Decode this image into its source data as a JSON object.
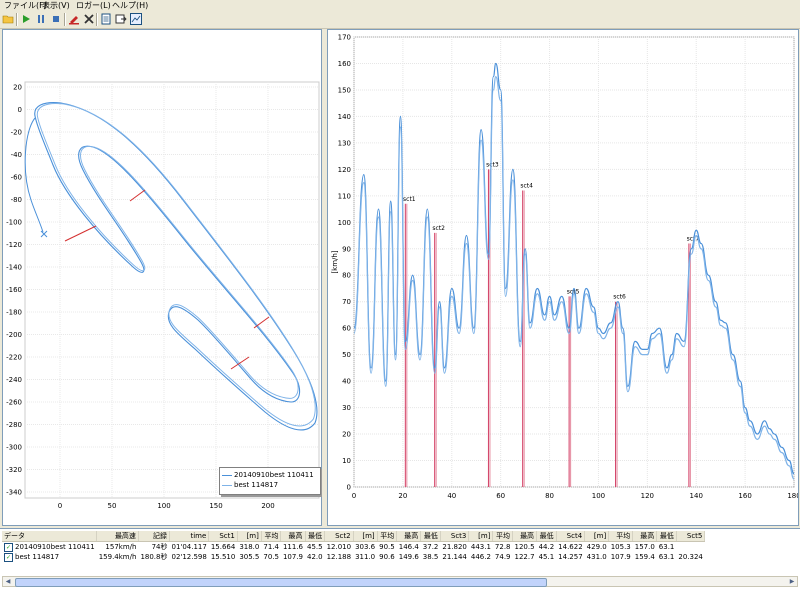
{
  "menu": [
    {
      "label": "ファイル(F)"
    },
    {
      "label": "表示(V)"
    },
    {
      "label": "ロガー(L)"
    },
    {
      "label": "ヘルプ(H)"
    }
  ],
  "toolbar": {
    "icons": [
      "open-folder-icon",
      "play-icon",
      "pause-icon",
      "stop-icon",
      "marker-icon",
      "delete-icon",
      "report-icon",
      "export-icon",
      "chart-icon"
    ]
  },
  "track_map": {
    "y_ticks": [
      "20",
      "0",
      "-20",
      "-40",
      "-60",
      "-80",
      "-100",
      "-120",
      "-140",
      "-160",
      "-180",
      "-200",
      "-220",
      "-240",
      "-260",
      "-280",
      "-300",
      "-320",
      "-340"
    ],
    "x_ticks": [
      "0",
      "50",
      "100",
      "150",
      "200"
    ],
    "legend": [
      "20140910best 110411",
      "best 114817"
    ]
  },
  "chart_data": {
    "type": "line",
    "ylabel": "[km/h]",
    "xlim": [
      0,
      180
    ],
    "ylim": [
      0,
      170
    ],
    "x_ticks": [
      "0",
      "20",
      "40",
      "60",
      "80",
      "100",
      "120",
      "140",
      "160",
      "180"
    ],
    "y_ticks": [
      "0",
      "10",
      "20",
      "30",
      "40",
      "50",
      "60",
      "70",
      "80",
      "90",
      "100",
      "110",
      "120",
      "130",
      "140",
      "150",
      "160",
      "170"
    ],
    "series": [
      {
        "name": "20140910best 110411",
        "color": "#4a90d9",
        "x": [
          0,
          4,
          7,
          10,
          13,
          15,
          17,
          19,
          21,
          24,
          27,
          30,
          33,
          35,
          37,
          40,
          43,
          46,
          49,
          52,
          55,
          57,
          58,
          60,
          62,
          65,
          68,
          70,
          72,
          75,
          78,
          80,
          82,
          85,
          88,
          90,
          92,
          95,
          98,
          100,
          102,
          105,
          108,
          110,
          112,
          115,
          118,
          120,
          122,
          125,
          128,
          130,
          132,
          135,
          138,
          140,
          142,
          145,
          148,
          150,
          152,
          155,
          158,
          160,
          162,
          165,
          168,
          170,
          172,
          175,
          178,
          180
        ],
        "y": [
          60,
          118,
          45,
          105,
          40,
          108,
          50,
          140,
          55,
          80,
          50,
          105,
          45,
          70,
          45,
          75,
          60,
          95,
          60,
          135,
          88,
          155,
          160,
          150,
          75,
          120,
          55,
          90,
          62,
          75,
          65,
          72,
          65,
          72,
          60,
          75,
          60,
          75,
          68,
          60,
          58,
          62,
          70,
          60,
          38,
          55,
          52,
          52,
          58,
          60,
          45,
          50,
          58,
          55,
          90,
          97,
          92,
          80,
          70,
          63,
          62,
          50,
          40,
          30,
          25,
          20,
          25,
          22,
          20,
          15,
          10,
          5
        ]
      },
      {
        "name": "best 114817",
        "color": "#7fb3e8",
        "x": [
          0,
          4,
          7,
          10,
          13,
          15,
          17,
          19,
          21,
          24,
          27,
          30,
          33,
          35,
          37,
          40,
          43,
          46,
          49,
          52,
          55,
          57,
          58,
          60,
          62,
          65,
          68,
          70,
          72,
          75,
          78,
          80,
          82,
          85,
          88,
          90,
          92,
          95,
          98,
          100,
          102,
          105,
          108,
          110,
          112,
          115,
          118,
          120,
          122,
          125,
          128,
          130,
          132,
          135,
          138,
          140,
          142,
          145,
          148,
          150,
          152,
          155,
          158,
          160,
          162,
          165,
          168,
          170,
          172,
          175,
          178,
          180
        ],
        "y": [
          58,
          115,
          43,
          102,
          38,
          104,
          48,
          136,
          52,
          78,
          48,
          102,
          43,
          68,
          43,
          72,
          58,
          92,
          58,
          131,
          86,
          150,
          155,
          146,
          72,
          116,
          53,
          88,
          60,
          73,
          63,
          70,
          63,
          70,
          58,
          73,
          58,
          73,
          66,
          58,
          56,
          60,
          68,
          58,
          36,
          53,
          50,
          50,
          56,
          58,
          43,
          48,
          56,
          53,
          88,
          95,
          90,
          78,
          68,
          61,
          60,
          48,
          38,
          28,
          23,
          18,
          23,
          20,
          18,
          13,
          8,
          3
        ]
      }
    ],
    "markers": [
      {
        "x": 21,
        "y": 107,
        "label": "sct1"
      },
      {
        "x": 33,
        "y": 96,
        "label": "sct2"
      },
      {
        "x": 55,
        "y": 120,
        "label": "sct3"
      },
      {
        "x": 69,
        "y": 112,
        "label": "sct4"
      },
      {
        "x": 88,
        "y": 72,
        "label": "sct5"
      },
      {
        "x": 107,
        "y": 70,
        "label": "sct6"
      },
      {
        "x": 137,
        "y": 92,
        "label": "sct7"
      }
    ]
  },
  "table": {
    "headers": [
      "データ",
      "最高速",
      "記録",
      "time",
      "Sct1",
      "[m]",
      "平均",
      "最高",
      "最低",
      "Sct2",
      "[m]",
      "平均",
      "最高",
      "最低",
      "Sct3",
      "[m]",
      "平均",
      "最高",
      "最低",
      "Sct4",
      "[m]",
      "平均",
      "最高",
      "最低",
      "Sct5"
    ],
    "rows": [
      [
        "20140910best 110411",
        "157km/h",
        "74秒",
        "01'04.117",
        "15.664",
        "318.0",
        "71.4",
        "111.6",
        "45.5",
        "12.010",
        "303.6",
        "90.5",
        "146.4",
        "37.2",
        "21.820",
        "443.1",
        "72.8",
        "120.5",
        "44.2",
        "14.622",
        "429.0",
        "105.3",
        "157.0",
        "63.1",
        ""
      ],
      [
        "best 114817",
        "159.4km/h",
        "180.8秒",
        "02'12.598",
        "15.510",
        "305.5",
        "70.5",
        "107.9",
        "42.0",
        "12.188",
        "311.0",
        "90.6",
        "149.6",
        "38.5",
        "21.144",
        "446.2",
        "74.9",
        "122.7",
        "45.1",
        "14.257",
        "431.0",
        "107.9",
        "159.4",
        "63.1",
        "20.324"
      ]
    ]
  }
}
